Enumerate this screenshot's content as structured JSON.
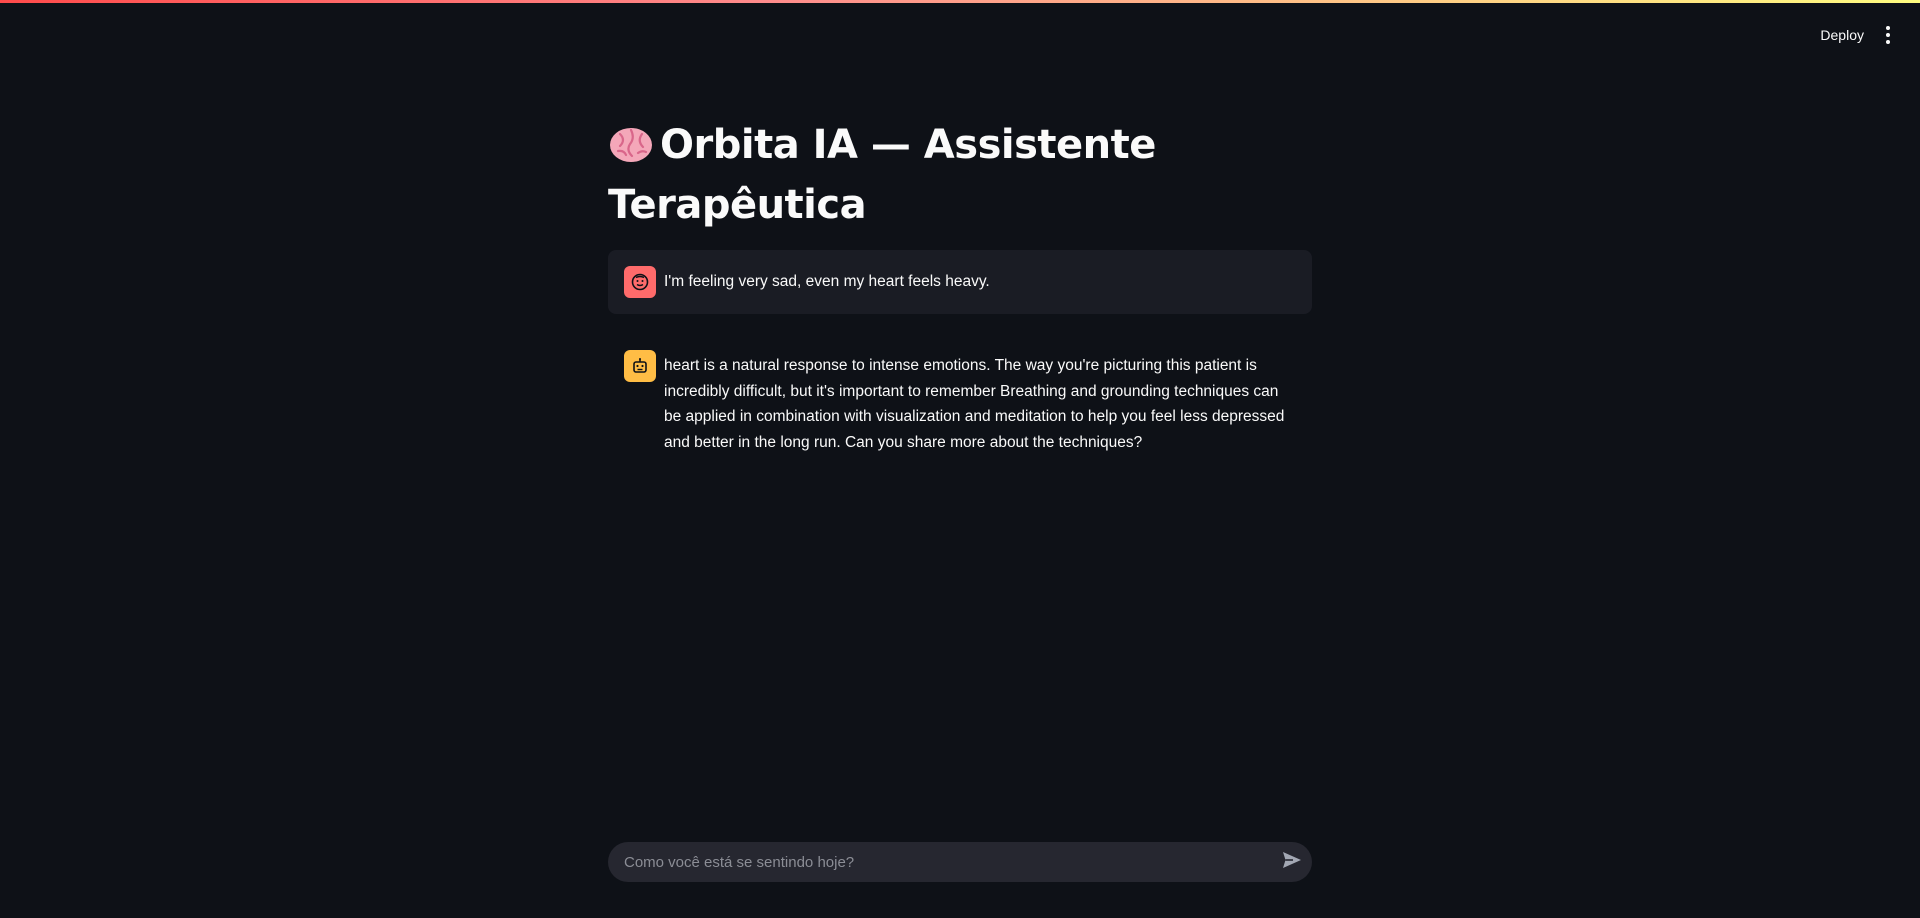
{
  "header": {
    "deploy_label": "Deploy",
    "menu_icon": "kebab-menu-icon"
  },
  "page": {
    "title": "Orbita IA — Assistente Terapêutica",
    "title_icon": "brain-icon"
  },
  "chat": {
    "messages": [
      {
        "role": "user",
        "avatar_icon": "user-face-icon",
        "text": "I'm feeling very sad, even my heart feels heavy."
      },
      {
        "role": "assistant",
        "avatar_icon": "robot-icon",
        "text": "heart is a natural response to intense emotions. The way you're picturing this patient is incredibly difficult, but it's important to remember Breathing and grounding techniques can be applied in combination with visualization and meditation to help you feel less depressed and better in the long run. Can you share more about the techniques?"
      }
    ]
  },
  "input": {
    "placeholder": "Como você está se sentindo hoje?",
    "value": "",
    "send_icon": "send-icon"
  },
  "colors": {
    "background": "#0e1117",
    "user_bubble": "#1a1c24",
    "user_avatar": "#ff6b6b",
    "bot_avatar": "#ffbd45",
    "input_bg": "#262730"
  }
}
